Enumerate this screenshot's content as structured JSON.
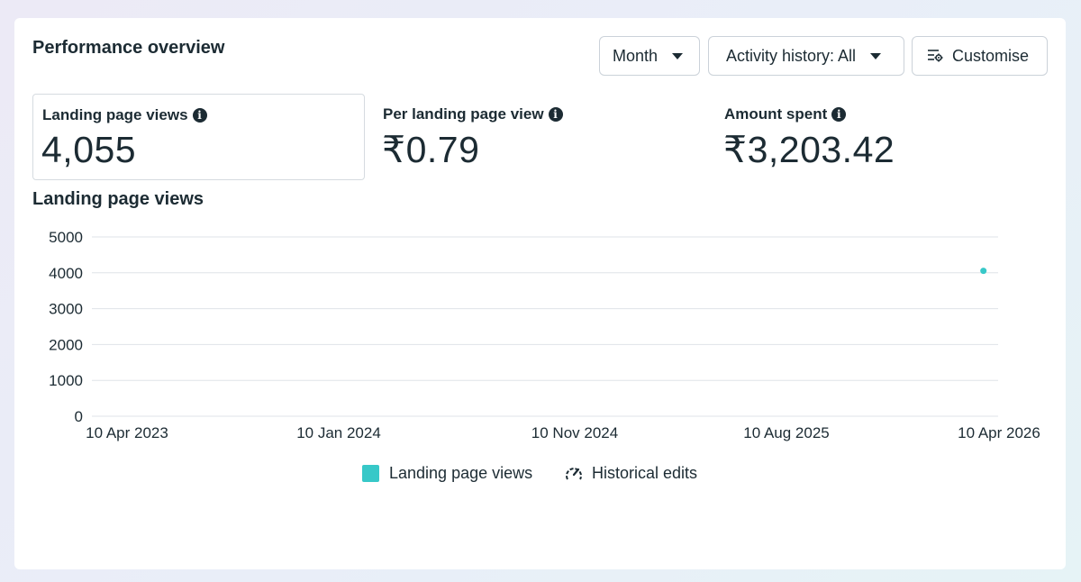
{
  "header": {
    "title": "Performance overview",
    "month_label": "Month",
    "activity_label": "Activity history: All",
    "customise_label": "Customise"
  },
  "metrics": [
    {
      "label": "Landing page views",
      "value": "4,055"
    },
    {
      "label": "Per landing page view",
      "value": "₹0.79"
    },
    {
      "label": "Amount spent",
      "value": "₹3,203.42"
    }
  ],
  "chart": {
    "title": "Landing page views",
    "legend": [
      "Landing page views",
      "Historical edits"
    ]
  },
  "colors": {
    "series": "#37c8c8",
    "grid": "#dfe3e8",
    "text": "#1c2b33"
  },
  "icons": {
    "customise": "settings-sliders-icon",
    "info": "info-icon",
    "historical": "gauge-edit-icon"
  },
  "chart_data": {
    "type": "scatter",
    "title": "Landing page views",
    "xlabel": "",
    "ylabel": "",
    "ylim": [
      0,
      5000
    ],
    "y_ticks": [
      0,
      1000,
      2000,
      3000,
      4000,
      5000
    ],
    "x_ticks": [
      "10 Apr 2023",
      "10 Jan 2024",
      "10 Nov 2024",
      "10 Aug 2025",
      "10 Apr 2026"
    ],
    "xlim": [
      "2023-04-10",
      "2026-04-10"
    ],
    "series": [
      {
        "name": "Landing page views",
        "points": [
          {
            "x": "2026-02-10",
            "y": 4055
          }
        ]
      }
    ],
    "grid": true,
    "legend_position": "bottom"
  }
}
